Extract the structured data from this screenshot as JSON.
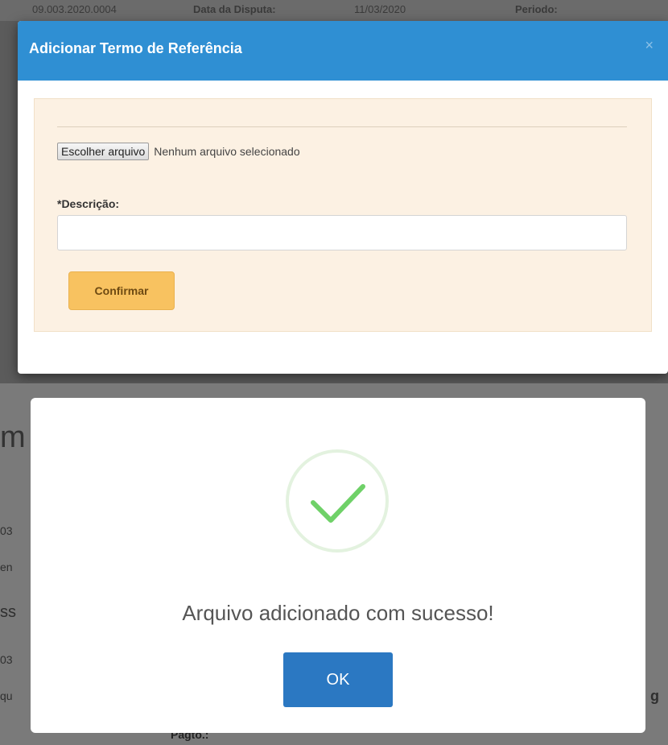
{
  "background_top": {
    "cells": [
      "09.003.2020.0004",
      "Data da Disputa:",
      "11/03/2020",
      "Periodo:"
    ]
  },
  "modal": {
    "title": "Adicionar Termo de Referência",
    "close_icon": "close-icon",
    "file_button_label": "Escolher arquivo",
    "file_status": "Nenhum arquivo selecionado",
    "description_label": "*Descrição:",
    "description_value": "",
    "confirm_label": "Confirmar",
    "colors": {
      "header": "#2f8fd3",
      "panel": "#fcf1e3",
      "confirm": "#f8c260"
    }
  },
  "background_bottom": {
    "heading_fragment": "m",
    "fragments": [
      "03",
      "en",
      "ss",
      "03",
      "qu",
      "g",
      "Pagto.:"
    ]
  },
  "alert": {
    "icon": "checkmark-icon",
    "message": "Arquivo adicionado com sucesso!",
    "ok_label": "OK",
    "colors": {
      "check": "#6fd168",
      "ok_button": "#2b78c2"
    }
  }
}
